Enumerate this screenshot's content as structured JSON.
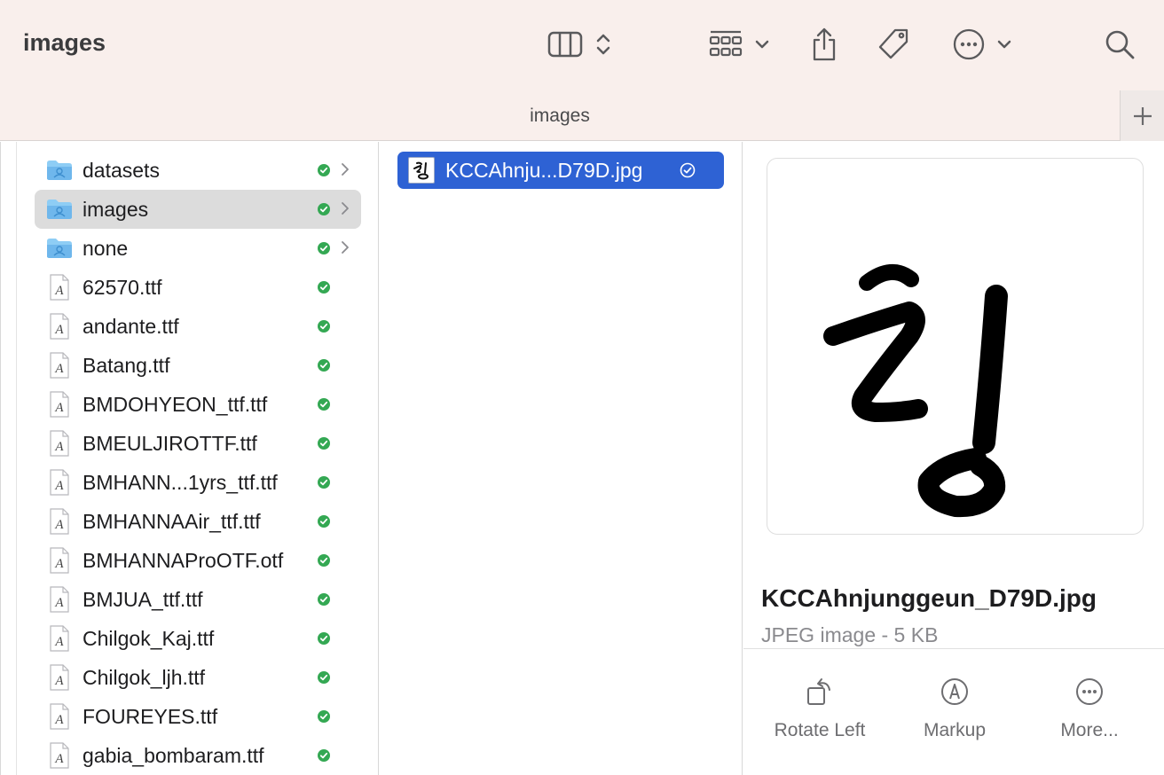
{
  "window": {
    "title": "images"
  },
  "toolbar": {
    "icons": [
      "column-view-icon",
      "view-switcher-chevrons-icon",
      "group-grid-icon",
      "chevron-down-icon",
      "share-icon",
      "tag-icon",
      "more-icon",
      "chevron-down-icon",
      "search-icon"
    ]
  },
  "pathbar": {
    "title": "images",
    "add_tab_icon": "plus-icon"
  },
  "sidebar": {
    "items": [
      {
        "label": "datasets",
        "icon": "folder-icon",
        "has_children": true,
        "selected": false
      },
      {
        "label": "images",
        "icon": "folder-icon",
        "has_children": true,
        "selected": true
      },
      {
        "label": "none",
        "icon": "folder-icon",
        "has_children": true,
        "selected": false
      },
      {
        "label": "62570.ttf",
        "icon": "font-file-icon"
      },
      {
        "label": "andante.ttf",
        "icon": "font-file-icon"
      },
      {
        "label": "Batang.ttf",
        "icon": "font-file-icon"
      },
      {
        "label": "BMDOHYEON_ttf.ttf",
        "icon": "font-file-icon"
      },
      {
        "label": "BMEULJIROTTF.ttf",
        "icon": "font-file-icon"
      },
      {
        "label": "BMHANN...1yrs_ttf.ttf",
        "icon": "font-file-icon"
      },
      {
        "label": "BMHANNAAir_ttf.ttf",
        "icon": "font-file-icon"
      },
      {
        "label": "BMHANNAProOTF.otf",
        "icon": "font-file-icon"
      },
      {
        "label": "BMJUA_ttf.ttf",
        "icon": "font-file-icon"
      },
      {
        "label": "Chilgok_Kaj.ttf",
        "icon": "font-file-icon"
      },
      {
        "label": "Chilgok_ljh.ttf",
        "icon": "font-file-icon"
      },
      {
        "label": "FOUREYES.ttf",
        "icon": "font-file-icon"
      },
      {
        "label": "gabia_bombaram.ttf",
        "icon": "font-file-icon"
      }
    ]
  },
  "file_column": {
    "items": [
      {
        "label": "KCCAhnju...D79D.jpg",
        "selected": true
      }
    ]
  },
  "preview": {
    "file_name": "KCCAhnjunggeun_D79D.jpg",
    "kind_size": "JPEG image - 5 KB",
    "actions": [
      {
        "label": "Rotate Left",
        "icon": "rotate-left-icon"
      },
      {
        "label": "Markup",
        "icon": "markup-icon"
      },
      {
        "label": "More...",
        "icon": "more-icon"
      }
    ]
  },
  "colors": {
    "selection": "#2e62d4",
    "toolbar_bg": "#f9efec",
    "sync_ok": "#34a853",
    "folder": "#6fb7ec"
  }
}
